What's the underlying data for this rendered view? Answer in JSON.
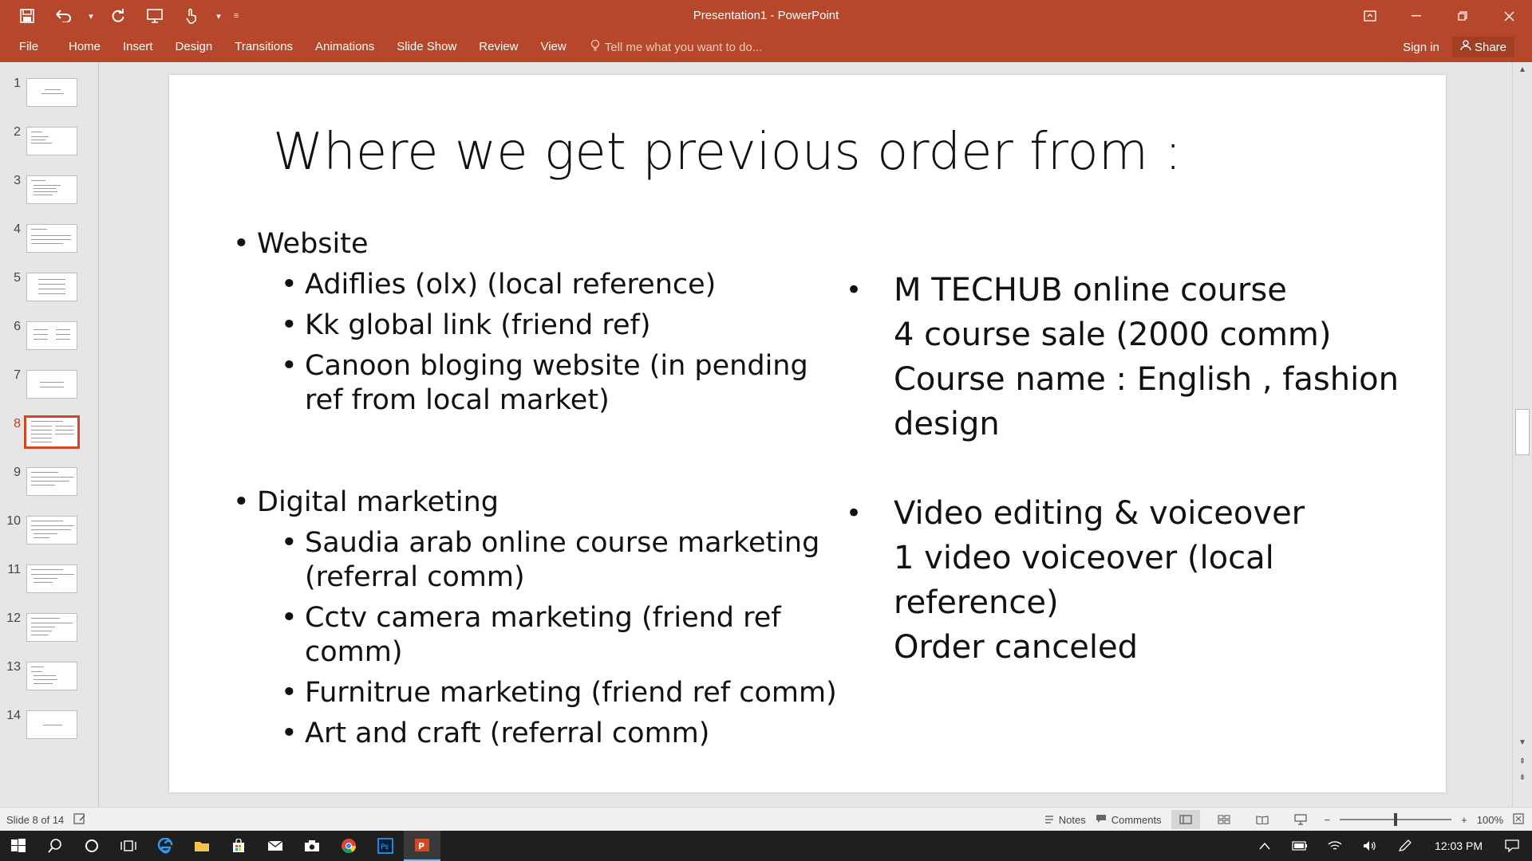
{
  "window": {
    "title": "Presentation1 - PowerPoint"
  },
  "qat": {
    "save_icon": "save-icon",
    "undo_icon": "undo-icon",
    "redo_icon": "redo-icon",
    "present_icon": "start-from-beginning-icon",
    "touch_icon": "touch-mode-icon",
    "customize_icon": "customize-qat-icon"
  },
  "ribbon": {
    "tabs": [
      "File",
      "Home",
      "Insert",
      "Design",
      "Transitions",
      "Animations",
      "Slide Show",
      "Review",
      "View"
    ],
    "tellme_placeholder": "Tell me what you want to do...",
    "signin": "Sign in",
    "share": "Share"
  },
  "thumbnails": {
    "numbers": [
      "1",
      "2",
      "3",
      "4",
      "5",
      "6",
      "7",
      "8",
      "9",
      "10",
      "11",
      "12",
      "13",
      "14"
    ],
    "active_index": 8
  },
  "slide": {
    "title": "Where we get previous order from :",
    "left": {
      "website": "Website",
      "website_items": [
        "Adiflies (olx) (local reference)",
        "Kk global link (friend ref)",
        "Canoon bloging website (in pending ref from local market)"
      ],
      "digital": "Digital marketing",
      "digital_items": [
        "Saudia arab online course marketing (referral comm)",
        "Cctv camera marketing (friend ref comm)",
        "Furnitrue marketing (friend ref comm)",
        "Art and craft (referral comm)"
      ]
    },
    "right": {
      "item1": {
        "line1": "M TECHUB online course",
        "line2": "4 course sale (2000 comm)",
        "line3": "Course  name : English , fashion design"
      },
      "item2": {
        "line1": "Video editing & voiceover",
        "line2": "1 video voiceover (local reference)",
        "line3": "Order canceled"
      }
    }
  },
  "statusbar": {
    "slide_info": "Slide 8 of 14",
    "notes": "Notes",
    "comments": "Comments",
    "zoom": "100%"
  },
  "taskbar": {
    "time": "12:03 PM"
  },
  "colors": {
    "accent": "#b7472a",
    "thumb_active": "#d24726",
    "taskbar": "#1f1f1f"
  }
}
